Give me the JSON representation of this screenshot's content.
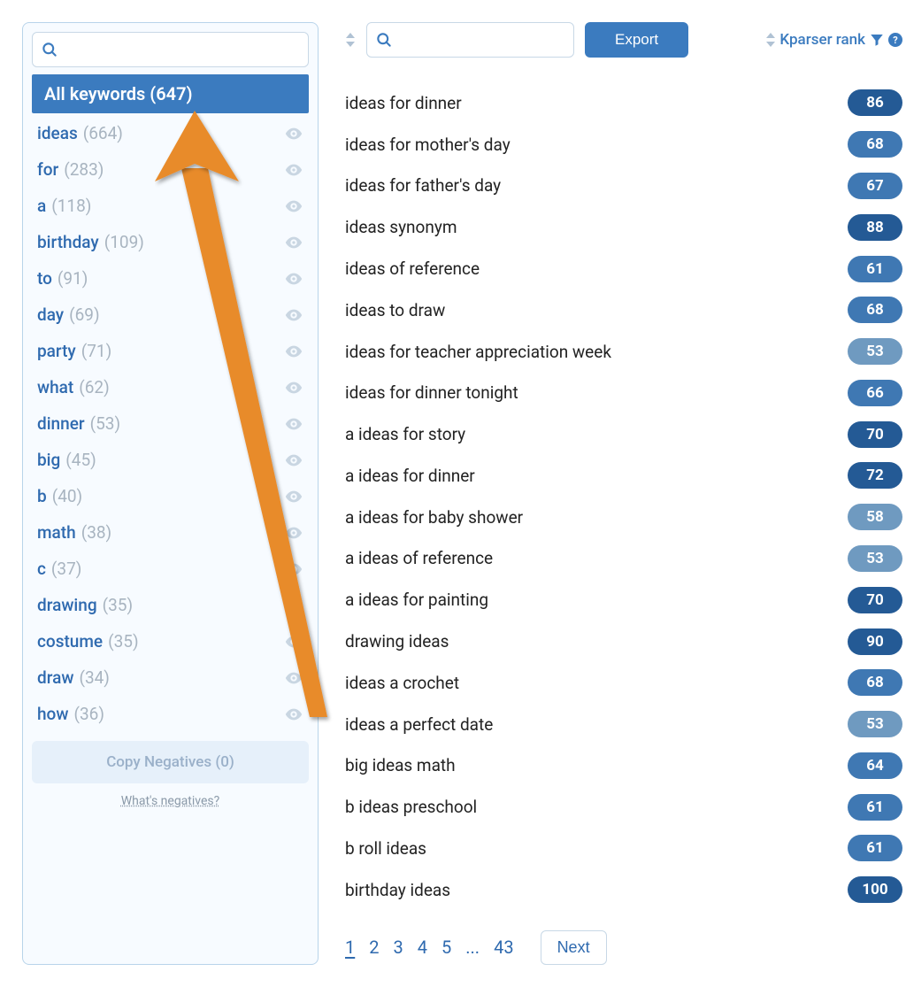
{
  "sidebar": {
    "search_placeholder": "",
    "all_keywords_label": "All keywords",
    "all_keywords_count": 647,
    "items": [
      {
        "word": "ideas",
        "count": 664
      },
      {
        "word": "for",
        "count": 283
      },
      {
        "word": "a",
        "count": 118
      },
      {
        "word": "birthday",
        "count": 109
      },
      {
        "word": "to",
        "count": 91
      },
      {
        "word": "day",
        "count": 69
      },
      {
        "word": "party",
        "count": 71
      },
      {
        "word": "what",
        "count": 62
      },
      {
        "word": "dinner",
        "count": 53
      },
      {
        "word": "big",
        "count": 45
      },
      {
        "word": "b",
        "count": 40
      },
      {
        "word": "math",
        "count": 38
      },
      {
        "word": "c",
        "count": 37
      },
      {
        "word": "drawing",
        "count": 35
      },
      {
        "word": "costume",
        "count": 35
      },
      {
        "word": "draw",
        "count": 34
      },
      {
        "word": "how",
        "count": 36
      }
    ],
    "copy_negatives_label": "Copy Negatives (0)",
    "whats_negatives_label": "What's negatives?"
  },
  "toolbar": {
    "search_placeholder": "",
    "export_label": "Export",
    "rank_header_label": "Kparser rank"
  },
  "colors": {
    "pill_dark": "#245a95",
    "pill_mid": "#3f78b3",
    "pill_light": "#6f9ac0"
  },
  "results": [
    {
      "text": "ideas for dinner",
      "rank": 86,
      "shade": "dark"
    },
    {
      "text": "ideas for mother's day",
      "rank": 68,
      "shade": "mid"
    },
    {
      "text": "ideas for father's day",
      "rank": 67,
      "shade": "mid"
    },
    {
      "text": "ideas synonym",
      "rank": 88,
      "shade": "dark"
    },
    {
      "text": "ideas of reference",
      "rank": 61,
      "shade": "mid"
    },
    {
      "text": "ideas to draw",
      "rank": 68,
      "shade": "mid"
    },
    {
      "text": "ideas for teacher appreciation week",
      "rank": 53,
      "shade": "light"
    },
    {
      "text": "ideas for dinner tonight",
      "rank": 66,
      "shade": "mid"
    },
    {
      "text": "a ideas for story",
      "rank": 70,
      "shade": "dark"
    },
    {
      "text": "a ideas for dinner",
      "rank": 72,
      "shade": "dark"
    },
    {
      "text": "a ideas for baby shower",
      "rank": 58,
      "shade": "light"
    },
    {
      "text": "a ideas of reference",
      "rank": 53,
      "shade": "light"
    },
    {
      "text": "a ideas for painting",
      "rank": 70,
      "shade": "dark"
    },
    {
      "text": "drawing ideas",
      "rank": 90,
      "shade": "dark"
    },
    {
      "text": "ideas a crochet",
      "rank": 68,
      "shade": "mid"
    },
    {
      "text": "ideas a perfect date",
      "rank": 53,
      "shade": "light"
    },
    {
      "text": "big ideas math",
      "rank": 64,
      "shade": "mid"
    },
    {
      "text": "b ideas preschool",
      "rank": 61,
      "shade": "mid"
    },
    {
      "text": "b roll ideas",
      "rank": 61,
      "shade": "mid"
    },
    {
      "text": "birthday ideas",
      "rank": 100,
      "shade": "dark"
    }
  ],
  "pagination": {
    "pages": [
      "1",
      "2",
      "3",
      "4",
      "5"
    ],
    "ellipsis": "...",
    "last_page": "43",
    "next_label": "Next",
    "current": "1"
  }
}
